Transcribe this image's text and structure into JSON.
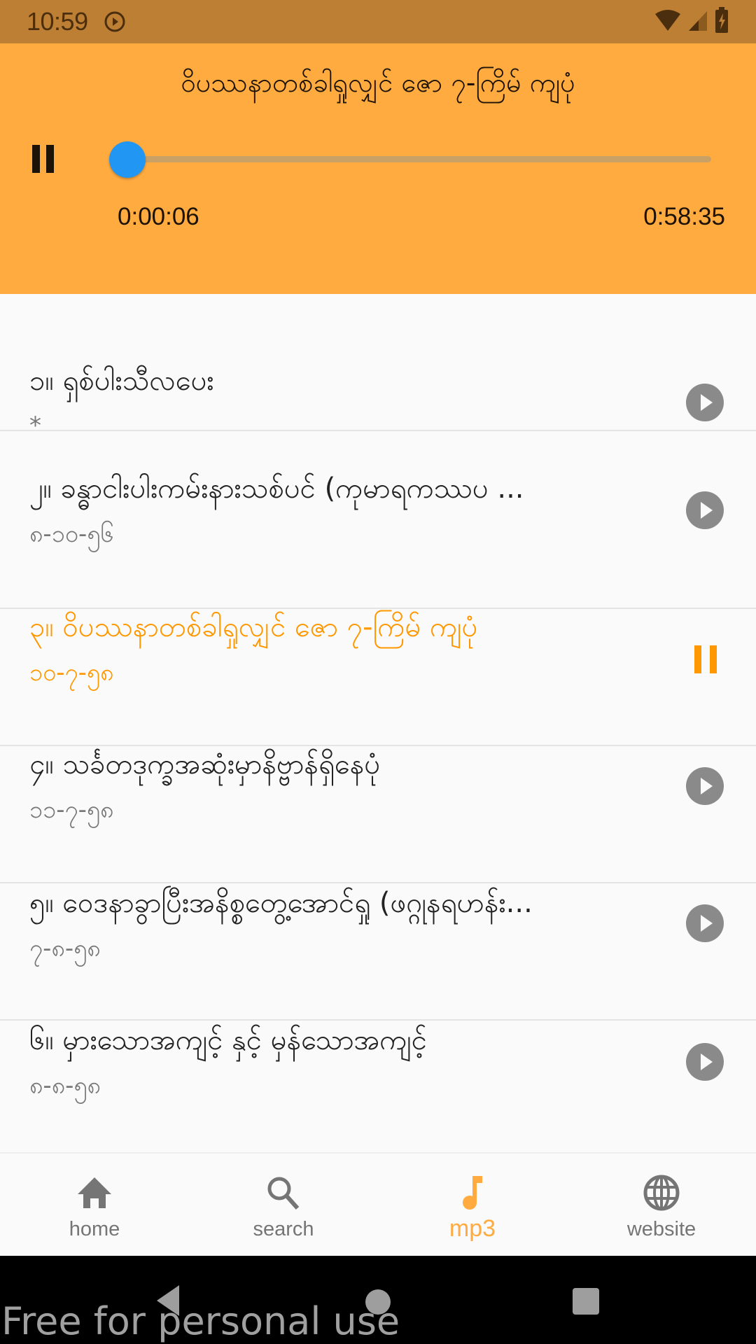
{
  "status_bar": {
    "time": "10:59",
    "icons": [
      "media-playing-icon",
      "wifi-icon",
      "cellular-signal-icon",
      "battery-charging-icon"
    ]
  },
  "player": {
    "title": "ဝိပဿနာတစ်ခါရှုလျှင် ဇော ၇-ကြိမ် ကျပုံ",
    "state": "playing",
    "control_icon": "pause-icon",
    "current_time": "0:00:06",
    "total_time": "0:58:35",
    "progress_fraction": 0.0017,
    "colors": {
      "background": "#ffab40",
      "thumb": "#2196f3",
      "track": "#c9a167"
    }
  },
  "tracks": [
    {
      "title": "၁။ ရှစ်ပါးသီလပေး",
      "subtitle": "*",
      "action_icon": "play-circle-icon",
      "active": false
    },
    {
      "title": "၂။ ခန္ဓာငါးပါးကမ်းနားသစ်ပင် (ကုမာရကဿပ ...",
      "subtitle": "၈-၁၀-၅၆",
      "action_icon": "play-circle-icon",
      "active": false
    },
    {
      "title": "၃။ ဝိပဿနာတစ်ခါရှုလျှင် ဇော ၇-ကြိမ် ကျပုံ",
      "subtitle": "၁၀-၇-၅၈",
      "action_icon": "pause-icon",
      "active": true
    },
    {
      "title": "၄။ သင်္ခတဒုက္ခအဆုံးမှာနိဗ္ဗာန်ရှိနေပုံ",
      "subtitle": "၁၁-၇-၅၈",
      "action_icon": "play-circle-icon",
      "active": false
    },
    {
      "title": "၅။ ဝေဒနာခွာပြီးအနိစ္စတွေ့အောင်ရှု (ဖဂ္ဂုနရဟန်း...",
      "subtitle": "၇-၈-၅၈",
      "action_icon": "play-circle-icon",
      "active": false
    },
    {
      "title": "၆။ မှားသောအကျင့် နှင့် မှန်သောအကျင့်",
      "subtitle": "၈-၈-၅၈",
      "action_icon": "play-circle-icon",
      "active": false
    }
  ],
  "bottom_nav": {
    "active": "mp3",
    "accent_color": "#ffab40",
    "items": [
      {
        "label": "home",
        "icon": "home-icon"
      },
      {
        "label": "search",
        "icon": "search-icon"
      },
      {
        "label": "mp3",
        "icon": "music-note-icon"
      },
      {
        "label": "website",
        "icon": "globe-icon"
      }
    ]
  },
  "system_nav": {
    "buttons": [
      "back",
      "home",
      "recents"
    ],
    "watermark": "Free for personal use"
  }
}
